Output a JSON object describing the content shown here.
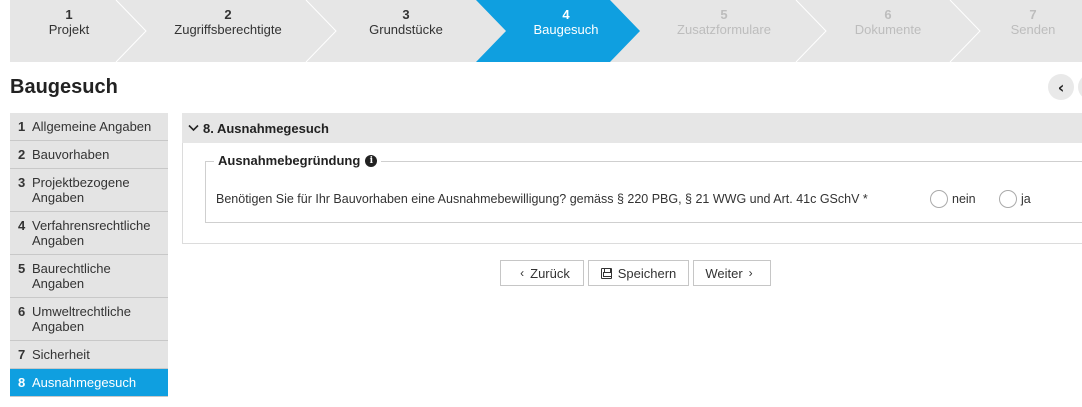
{
  "stepper": {
    "steps": [
      {
        "num": "1",
        "label": "Projekt",
        "state": "done"
      },
      {
        "num": "2",
        "label": "Zugriffsberechtigte",
        "state": "done"
      },
      {
        "num": "3",
        "label": "Grundstücke",
        "state": "done"
      },
      {
        "num": "4",
        "label": "Baugesuch",
        "state": "active"
      },
      {
        "num": "5",
        "label": "Zusatzformulare",
        "state": "inactive"
      },
      {
        "num": "6",
        "label": "Dokumente",
        "state": "inactive"
      },
      {
        "num": "7",
        "label": "Senden",
        "state": "inactive"
      }
    ],
    "active_color": "#0f9fe0"
  },
  "page": {
    "title": "Baugesuch",
    "prev_icon": "chevron-left-icon",
    "next_icon": "chevron-right-icon"
  },
  "sidebar": {
    "items": [
      {
        "num": "1",
        "label": "Allgemeine Angaben"
      },
      {
        "num": "2",
        "label": "Bauvorhaben"
      },
      {
        "num": "3",
        "label": "Projektbezogene Angaben"
      },
      {
        "num": "4",
        "label": "Verfahrensrechtliche Angaben"
      },
      {
        "num": "5",
        "label": "Baurechtliche Angaben"
      },
      {
        "num": "6",
        "label": "Umweltrechtliche Angaben"
      },
      {
        "num": "7",
        "label": "Sicherheit"
      },
      {
        "num": "8",
        "label": "Ausnahmegesuch"
      }
    ],
    "active_index": 7
  },
  "section": {
    "title": "8. Ausnahmegesuch",
    "fieldset_legend": "Ausnahmebegründung",
    "question": "Benötigen Sie für Ihr Bauvorhaben eine Ausnahmebewilligung? gemäss § 220 PBG, § 21 WWG und Art. 41c GSchV *",
    "options": [
      "nein",
      "ja"
    ]
  },
  "buttons": {
    "back": "Zurück",
    "save": "Speichern",
    "next": "Weiter"
  }
}
